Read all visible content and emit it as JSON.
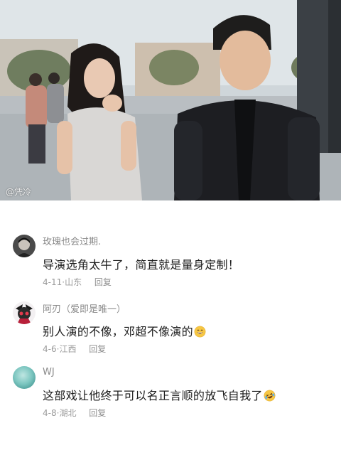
{
  "video": {
    "watermark": "@凭冷"
  },
  "comments": [
    {
      "username": "玫瑰也会过期.",
      "text": "导演选角太牛了，简直就是量身定制！",
      "date": "4-11",
      "location": "山东",
      "reply_label": "回复",
      "emoji": "",
      "avatar": "dark-portrait-avatar"
    },
    {
      "username": "阿刃（爱即是唯一）",
      "text": "别人演的不像，邓超不像演的",
      "date": "4-6",
      "location": "江西",
      "reply_label": "回复",
      "emoji": "grinning-face-emoji",
      "avatar": "anime-character-avatar"
    },
    {
      "username": "WJ",
      "text": "这部戏让他终于可以名正言顺的放飞自我了",
      "date": "4-8",
      "location": "湖北",
      "reply_label": "回复",
      "emoji": "rolling-laughing-emoji",
      "avatar": "teal-gradient-avatar"
    }
  ],
  "colors": {
    "username": "#8a8a8a",
    "text": "#1c1c1c",
    "meta": "#9a9a9a"
  }
}
